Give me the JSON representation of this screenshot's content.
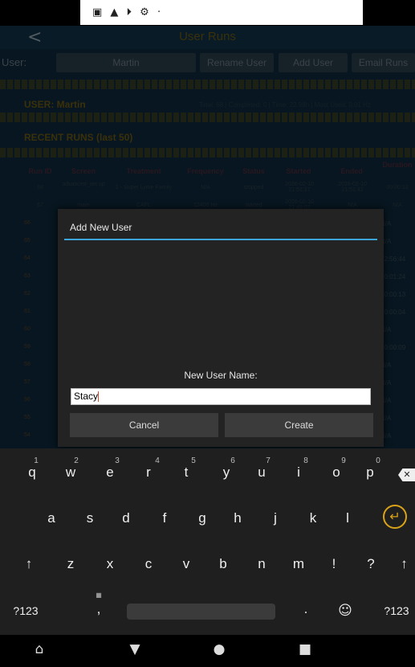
{
  "app": {
    "back_glyph": "<",
    "title": "User Runs",
    "user_label": "User:",
    "user_value": "Martin",
    "buttons": [
      "Rename User",
      "Add User",
      "Email Runs"
    ],
    "user_heading": "USER: Martin",
    "stats": "Total: 68 | Completed: 0 | Time: 22.98h | Most Used: 0.01 Hz",
    "recent_heading": "RECENT RUNS (last 50)",
    "table": {
      "headers": [
        "Run ID",
        "Screen",
        "Treatment",
        "Frequency",
        "Status",
        "Started",
        "Ended",
        "Duration"
      ],
      "rows": [
        {
          "id": "68",
          "screen": "advanced_set up",
          "treatment": "1 - Super Lyme Family",
          "frequency": "N/A",
          "status": "stopped",
          "started": "2026-02-10 21:51:17",
          "ended": "2026-02-10 21:51:42",
          "duration": "00:00:12"
        },
        {
          "id": "67",
          "screen": "main",
          "treatment": "CAFL",
          "frequency": "12400 Hz",
          "status": "started",
          "started": "2026-02-10 21:48:07",
          "ended": "N/A",
          "duration": "N/A"
        }
      ],
      "row_ids": [
        "66",
        "65",
        "64",
        "63",
        "62",
        "61",
        "60",
        "59",
        "58",
        "57",
        "56",
        "55",
        "54",
        "53"
      ],
      "right_col": [
        "N/A",
        "N/A",
        "22:56:44",
        "00:01:24",
        "00:00:13",
        "00:00:04",
        "N/A",
        "00:00:09",
        "N/A",
        "N/A",
        "N/A",
        "N/A",
        "N/A",
        "N/A"
      ]
    }
  },
  "dialog": {
    "title": "Add New User",
    "label": "New User Name:",
    "input_value": "Stacy",
    "cancel": "Cancel",
    "create": "Create"
  },
  "keyboard": {
    "row1": [
      "q",
      "w",
      "e",
      "r",
      "t",
      "y",
      "u",
      "i",
      "o",
      "p"
    ],
    "row1_nums": [
      "1",
      "2",
      "3",
      "4",
      "5",
      "6",
      "7",
      "8",
      "9",
      "0"
    ],
    "row2": [
      "a",
      "s",
      "d",
      "f",
      "g",
      "h",
      "j",
      "k",
      "l"
    ],
    "row3": [
      "↑",
      "z",
      "x",
      "c",
      "v",
      "b",
      "n",
      "m",
      "!",
      "?",
      "↑"
    ],
    "symbols_left": "?123",
    "comma": ",",
    "period": ".",
    "emoji": "☺",
    "symbols_right": "?123",
    "enter_glyph": "↵",
    "backspace_glyph": "✕"
  },
  "nav": {
    "icons": [
      "home-gesture-icon",
      "back-triangle-icon",
      "home-circle-icon",
      "recents-square-icon"
    ]
  },
  "colors": {
    "accent": "#3ba5d8",
    "enter_ring": "#d9a218",
    "app_bg": "#0c2232"
  }
}
